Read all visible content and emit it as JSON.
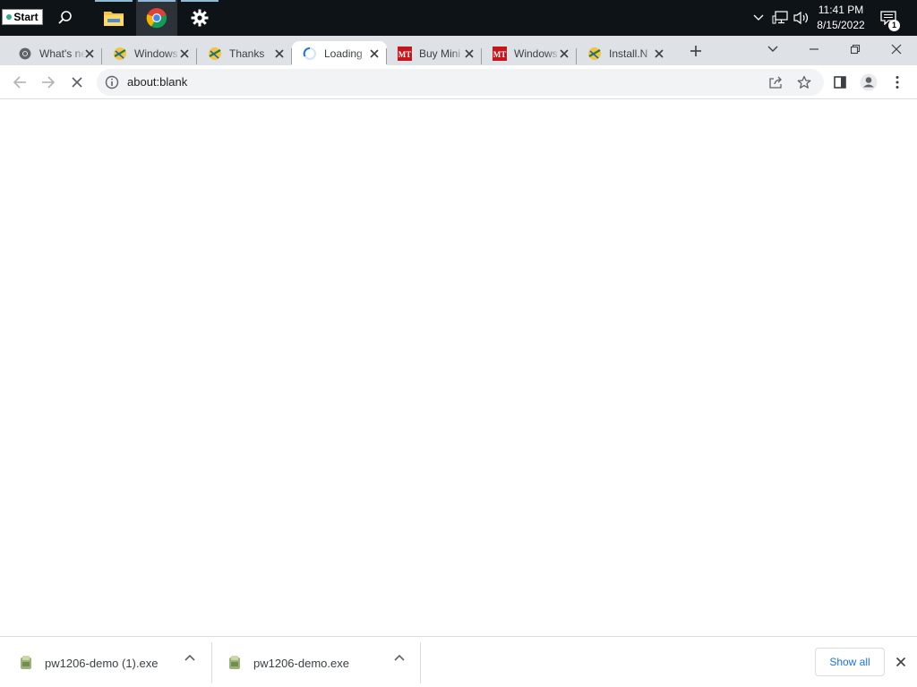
{
  "taskbar": {
    "start_label": "Start",
    "clock_time": "11:41 PM",
    "clock_date": "8/15/2022",
    "notification_count": "1",
    "pinned_icons": [
      "search-icon",
      "file-explorer-icon",
      "chrome-icon",
      "settings-icon"
    ]
  },
  "browser": {
    "tabs": [
      {
        "title": "What's new",
        "favicon": "chrome-icon"
      },
      {
        "title": "Windows",
        "favicon": "pwa-icon"
      },
      {
        "title": "Thanks",
        "favicon": "pwa-icon"
      },
      {
        "title": "Loading",
        "favicon": "loading-spinner-icon",
        "active": true
      },
      {
        "title": "Buy Mini",
        "favicon": "mt-logo-icon"
      },
      {
        "title": "Windows",
        "favicon": "mt-logo-icon"
      },
      {
        "title": "Install.N",
        "favicon": "pwa-icon"
      }
    ],
    "address": "about:blank"
  },
  "downloads": {
    "items": [
      {
        "filename": "pw1206-demo (1).exe"
      },
      {
        "filename": "pw1206-demo.exe"
      }
    ],
    "show_all_label": "Show all"
  },
  "colors": {
    "taskbar_bg": "#0e1318",
    "tabstrip_bg": "#dee1e6",
    "accent_blue": "#1a73e8",
    "mt_red": "#c4161c"
  }
}
